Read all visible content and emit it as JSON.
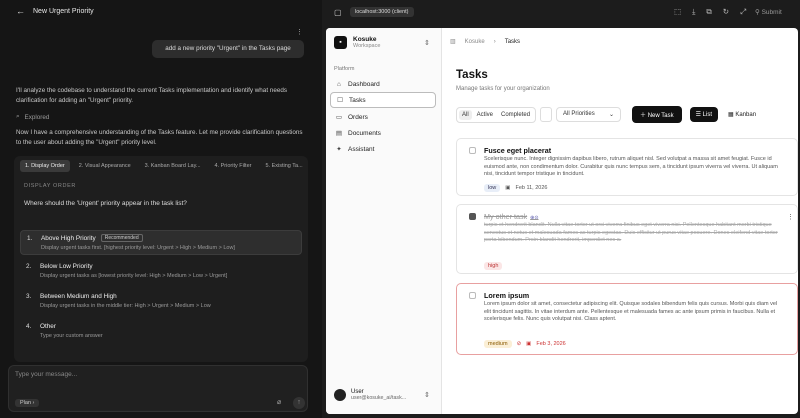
{
  "chat": {
    "header_title": "New Urgent Priority",
    "user_message": "add a new priority \"Urgent\" in the Tasks page",
    "para1": "I'll analyze the codebase to understand the current Tasks implementation and identify what needs clarification for adding an \"Urgent\" priority.",
    "explored": "Explored",
    "para2": "Now I have a comprehensive understanding of the Tasks feature. Let me provide clarification questions to the user about adding the \"Urgent\" priority level.",
    "tabs": [
      "1. Display Order",
      "2. Visual Appearance",
      "3. Kanban Board Lay...",
      "4. Priority Filter",
      "5. Existing Ta..."
    ],
    "question_label": "DISPLAY ORDER",
    "question": "Where should the 'Urgent' priority appear in the task list?",
    "options": [
      {
        "num": "1.",
        "title": "Above High Priority",
        "badge": "Recommended",
        "desc": "Display urgent tasks first. [highest priority level: Urgent > High > Medium > Low]"
      },
      {
        "num": "2.",
        "title": "Below Low Priority",
        "badge": "",
        "desc": "Display urgent tasks as [lowest priority level: High > Medium > Low > Urgent]"
      },
      {
        "num": "3.",
        "title": "Between Medium and High",
        "badge": "",
        "desc": "Display urgent tasks in the middle tier: High > Urgent > Medium > Low"
      },
      {
        "num": "4.",
        "title": "Other",
        "badge": "",
        "desc": "Type your custom answer"
      }
    ],
    "input_placeholder": "Type your message...",
    "plan_label": "Plan"
  },
  "topbar": {
    "url": "localhost:3000 (client)",
    "submit": "Submit"
  },
  "sidebar": {
    "workspace": "Kosuke",
    "workspace_sub": "Workspace",
    "section": "Platform",
    "items": [
      {
        "label": "Dashboard",
        "icon": "home-icon"
      },
      {
        "label": "Tasks",
        "icon": "tasks-icon"
      },
      {
        "label": "Orders",
        "icon": "orders-icon"
      },
      {
        "label": "Documents",
        "icon": "documents-icon"
      },
      {
        "label": "Assistant",
        "icon": "assistant-icon"
      }
    ],
    "user_name": "User",
    "user_email": "user@kosuke_ai/task..."
  },
  "main": {
    "crumb_root": "Kosuke",
    "crumb_current": "Tasks",
    "title": "Tasks",
    "subtitle": "Manage tasks for your organization",
    "filters": {
      "all": "All",
      "active": "Active",
      "completed": "Completed"
    },
    "priority_select": "All Priorities",
    "new_task": "New Task",
    "list": "List",
    "kanban": "Kanban",
    "cards": [
      {
        "title": "Fusce eget placerat",
        "desc": "Scelerisque nunc. Integer dignissim dapibus libero, rutrum aliquet nisl. Sed volutpat a massa sit amet feugiat. Fusce id euismod ante, non condimentum dolor. Curabitur quis nunc tempus sem, a tincidunt ipsum viverra vel viverra. Ut aliquam nisi, tincidunt tempor tristique in tincidunt.",
        "priority": "low",
        "date": "Feb 11, 2026"
      },
      {
        "title": "My other task",
        "desc": "turpis et hendrerit blandit. Nulla vitae tortor ut orci viverra finibus eget viverra nisi. Pellentesque habitant morbi tristique senectus et netus et malesuada fames ac turpis egestas. Duis efficitur ut purus vitae posuere. Donec eleifend vitae tortor porta bibendum. Proin blandit hendrerit, imperdiet nec a.",
        "priority": "high",
        "date": ""
      },
      {
        "title": "Lorem ipsum",
        "desc": "Lorem ipsum dolor sit amet, consectetur adipiscing elit. Quisque sodales bibendum felis quis cursus. Morbi quis diam vel elit tincidunt sagittis. In vitae interdum ante. Pellentesque et malesuada fames ac ante ipsum primis in faucibus. Nulla et scelerisque felis. Nunc quis volutpat nisi. Class aptent.",
        "priority": "medium",
        "date": "Feb 3, 2026"
      }
    ]
  }
}
